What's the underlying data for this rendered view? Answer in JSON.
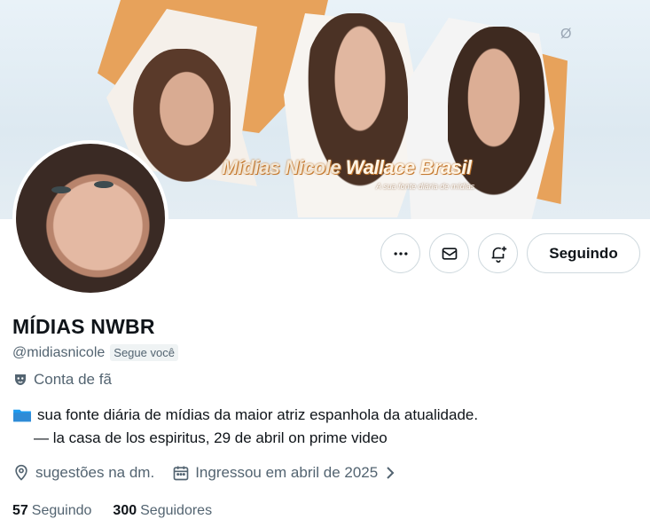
{
  "banner": {
    "title_part1": "Mídias Nicole",
    "title_part2": "Wallace Brasil",
    "subtitle": "A sua fonte diária de mídias"
  },
  "actions": {
    "more_icon": "more-horizontal-icon",
    "message_icon": "envelope-icon",
    "notify_icon": "bell-plus-icon",
    "follow_label": "Seguindo"
  },
  "profile": {
    "display_name": "MÍDIAS NWBR",
    "handle": "@midiasnicole",
    "follows_you_badge": "Segue você",
    "account_type": "Conta de fã",
    "bio_line1": "sua fonte diária de mídias da maior atriz espanhola da atualidade.",
    "bio_line2": "— la casa de los espiritus, 29 de abril on prime video",
    "location": "sugestões na dm.",
    "joined": "Ingressou em abril de 2025",
    "following_count": "57",
    "following_label": "Seguindo",
    "followers_count": "300",
    "followers_label": "Seguidores"
  },
  "colors": {
    "text": "#0f1419",
    "secondary": "#536471",
    "border": "#cfd9de",
    "folder": "#1d9bf0",
    "banner_accent": "#e7a25b"
  }
}
